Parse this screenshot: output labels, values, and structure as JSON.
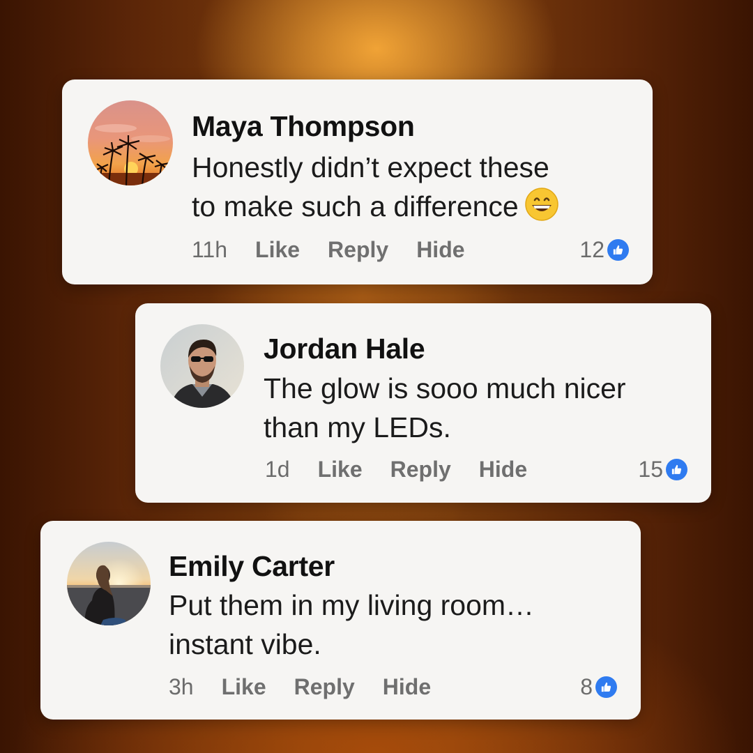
{
  "comments": [
    {
      "author": "Maya Thompson",
      "lines": [
        "Honestly didn’t expect these",
        "to make such a difference"
      ],
      "emoji": "grinning-face",
      "time": "11h",
      "actions": [
        "Like",
        "Reply",
        "Hide"
      ],
      "like_count": "12",
      "avatar": "palm-sunset-avatar"
    },
    {
      "author": "Jordan Hale",
      "lines": [
        "The glow is sooo much nicer",
        "than my LEDs."
      ],
      "time": "1d",
      "actions": [
        "Like",
        "Reply",
        "Hide"
      ],
      "like_count": "15",
      "avatar": "man-sunglasses-avatar"
    },
    {
      "author": "Emily Carter",
      "lines": [
        "Put them in my living room…",
        "instant vibe."
      ],
      "time": "3h",
      "actions": [
        "Like",
        "Reply",
        "Hide"
      ],
      "like_count": "8",
      "avatar": "woman-sea-sunset-avatar"
    }
  ],
  "colors": {
    "card": "#f6f5f3",
    "like_blue": "#2f7bf0",
    "meta_gray": "#6b6b6b"
  }
}
